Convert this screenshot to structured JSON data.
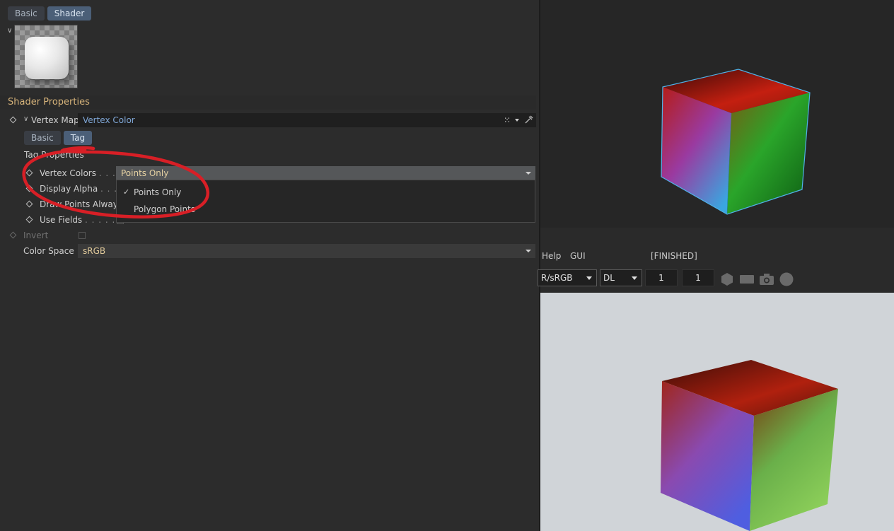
{
  "top_tabs": [
    {
      "label": "Basic",
      "active": false
    },
    {
      "label": "Shader",
      "active": true
    }
  ],
  "section_title": "Shader Properties",
  "vertex_map": {
    "label": "Vertex Map",
    "value": "Vertex Color"
  },
  "sub_tabs": [
    {
      "label": "Basic",
      "active": false
    },
    {
      "label": "Tag",
      "active": true
    }
  ],
  "tag_properties_label": "Tag Properties",
  "properties": {
    "vertex_colors": {
      "label": "Vertex Colors",
      "dots": ". . . .",
      "value": "Points Only"
    },
    "display_alpha": {
      "label": "Display Alpha",
      "dots": ". . ."
    },
    "draw_points_always": {
      "label": "Draw Points Always"
    },
    "use_fields": {
      "label": "Use Fields",
      "dots": ". . . . . ."
    },
    "invert": {
      "label": "Invert"
    },
    "color_space": {
      "label": "Color Space",
      "value": "sRGB"
    }
  },
  "dropdown_menu": {
    "items": [
      {
        "label": "Points Only",
        "checked": true
      },
      {
        "label": "Polygon Points",
        "checked": false
      }
    ]
  },
  "render_window": {
    "menu": [
      "Help",
      "GUI"
    ],
    "status": "[FINISHED]",
    "view_transform": "R/sRGB",
    "mode": "DL",
    "field_a": "1",
    "field_b": "1"
  },
  "colors": {
    "accent_orange": "#d6b37a",
    "tab_active": "#4b5f78",
    "link_blue": "#7fa6d6",
    "annotation_red": "#d81f26"
  }
}
